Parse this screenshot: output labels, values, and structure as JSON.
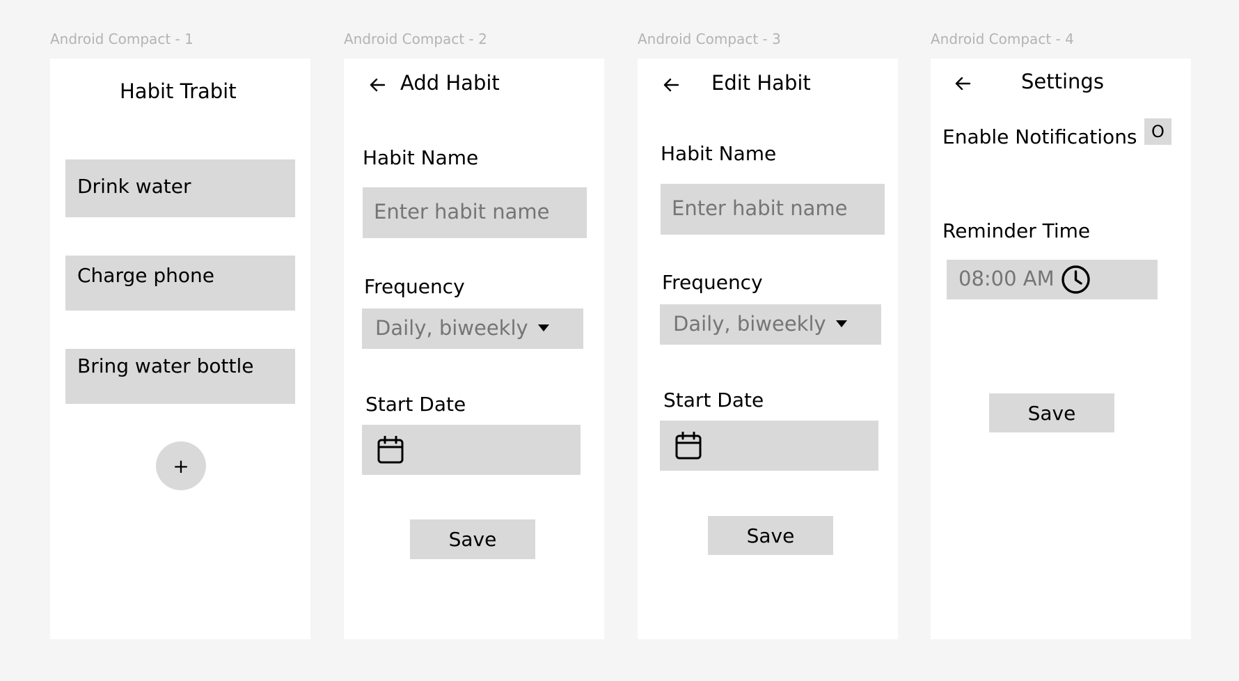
{
  "frames": [
    {
      "label": "Android Compact - 1",
      "title": "Habit Trabit",
      "habits": [
        "Drink water",
        "Charge phone",
        "Bring water bottle"
      ],
      "fab_label": "+"
    },
    {
      "label": "Android Compact - 2",
      "title": "Add Habit",
      "habit_name_label": "Habit Name",
      "habit_name_placeholder": "Enter habit name",
      "frequency_label": "Frequency",
      "frequency_value": "Daily, biweekly",
      "start_date_label": "Start Date",
      "save_label": "Save"
    },
    {
      "label": "Android Compact - 3",
      "title": "Edit Habit",
      "habit_name_label": "Habit Name",
      "habit_name_placeholder": "Enter habit name",
      "frequency_label": "Frequency",
      "frequency_value": "Daily, biweekly",
      "start_date_label": "Start Date",
      "save_label": "Save"
    },
    {
      "label": "Android Compact - 4",
      "title": "Settings",
      "notifications_label": "Enable Notifications",
      "notifications_toggle": "O",
      "reminder_label": "Reminder Time",
      "reminder_value": "08:00 AM",
      "save_label": "Save"
    }
  ],
  "icons": {
    "back": "arrow-left-icon",
    "calendar": "calendar-icon",
    "clock": "clock-icon",
    "dropdown": "chevron-down-icon"
  },
  "colors": {
    "background": "#f5f5f5",
    "frame": "#ffffff",
    "field": "#d9d9d9",
    "placeholder": "#757575",
    "frame_label": "#b3b3b3"
  }
}
